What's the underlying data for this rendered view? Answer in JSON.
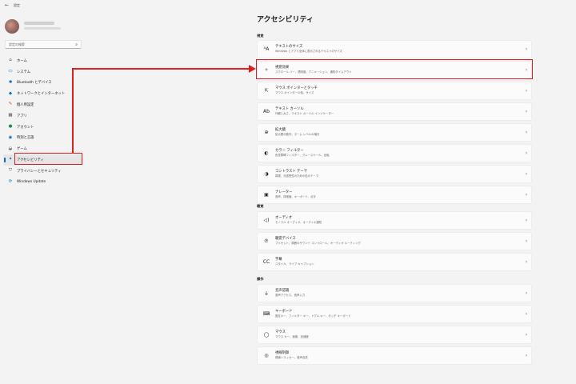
{
  "window": {
    "title": "設定",
    "back_glyph": "←"
  },
  "sidebar": {
    "search_placeholder": "設定の検索",
    "search_icon": "search-icon",
    "items": [
      {
        "label": "ホーム",
        "icon": "home-icon",
        "glyph": "⌂",
        "color": "#444444"
      },
      {
        "label": "システム",
        "icon": "system-icon",
        "glyph": "▭",
        "color": "#0067c0"
      },
      {
        "label": "Bluetooth とデバイス",
        "icon": "bluetooth-icon",
        "glyph": "✱",
        "color": "#0067c0"
      },
      {
        "label": "ネットワークとインターネット",
        "icon": "network-icon",
        "glyph": "◆",
        "color": "#0078d4"
      },
      {
        "label": "個人用設定",
        "icon": "personalization-icon",
        "glyph": "✎",
        "color": "#c05a1a"
      },
      {
        "label": "アプリ",
        "icon": "apps-icon",
        "glyph": "▦",
        "color": "#555555"
      },
      {
        "label": "アカウント",
        "icon": "account-icon",
        "glyph": "●",
        "color": "#1f8a4c"
      },
      {
        "label": "時刻と言語",
        "icon": "time-language-icon",
        "glyph": "◉",
        "color": "#0067c0"
      },
      {
        "label": "ゲーム",
        "icon": "gaming-icon",
        "glyph": "◒",
        "color": "#666666"
      },
      {
        "label": "アクセシビリティ",
        "icon": "accessibility-icon",
        "glyph": "✦",
        "color": "#0067c0",
        "active": true
      },
      {
        "label": "プライバシーとセキュリティ",
        "icon": "shield-icon",
        "glyph": "⛉",
        "color": "#555555"
      },
      {
        "label": "Windows Update",
        "icon": "windows-update-icon",
        "glyph": "⟳",
        "color": "#0078d4"
      }
    ]
  },
  "main": {
    "title": "アクセシビリティ",
    "sections": [
      {
        "title": "視覚",
        "cards": [
          {
            "title": "テキストのサイズ",
            "desc": "Windows とアプリ全体に表示されるテキストのサイズ",
            "icon": "text-size-icon",
            "glyph": "ᴬA"
          },
          {
            "title": "視覚効果",
            "desc": "スクロール バー、透明度、アニメーション、通知タイムアウト",
            "icon": "visual-effects-icon",
            "glyph": "✧"
          },
          {
            "title": "マウス ポインターとタッチ",
            "desc": "マウス ポインターの色、サイズ",
            "icon": "mouse-pointer-icon",
            "glyph": "⇱"
          },
          {
            "title": "テキスト カーソル",
            "desc": "外観と太さ、テキスト カーソル インジケーター",
            "icon": "text-cursor-icon",
            "glyph": "Ab"
          },
          {
            "title": "拡大鏡",
            "desc": "拡大鏡の動作、ズーム レベルの増分",
            "icon": "magnifier-icon",
            "glyph": "⊕"
          },
          {
            "title": "カラー フィルター",
            "desc": "色覚障碍フィルター、グレースケール、反転",
            "icon": "color-filter-icon",
            "glyph": "◐"
          },
          {
            "title": "コントラスト テーマ",
            "desc": "弱視、光感受性のための色のテーマ",
            "icon": "contrast-theme-icon",
            "glyph": "◑"
          },
          {
            "title": "ナレーター",
            "desc": "音声、詳細度、キーボード、点字",
            "icon": "narrator-icon",
            "glyph": "▣"
          }
        ]
      },
      {
        "title": "聴覚",
        "cards": [
          {
            "title": "オーディオ",
            "desc": "モノラル オーディオ、オーディオ通知",
            "icon": "audio-icon",
            "glyph": "◁)"
          },
          {
            "title": "聴覚デバイス",
            "desc": "プリセット、周囲のサウンド コントロール、オーディオ ルーティング",
            "icon": "hearing-device-icon",
            "glyph": "℗"
          },
          {
            "title": "字幕",
            "desc": "スタイル、ライブ キャプション",
            "icon": "captions-icon",
            "glyph": "CC"
          }
        ]
      },
      {
        "title": "操作",
        "cards": [
          {
            "title": "音声認識",
            "desc": "音声アクセス、音声入力",
            "icon": "microphone-icon",
            "glyph": "⏚"
          },
          {
            "title": "キーボード",
            "desc": "固定キー、フィルター キー、トグル キー、タッチ キーボード",
            "icon": "keyboard-icon",
            "glyph": "⌨"
          },
          {
            "title": "マウス",
            "desc": "マウス キー、速度、加速度",
            "icon": "mouse-icon",
            "glyph": "◯"
          },
          {
            "title": "視線制御",
            "desc": "視線トラッカー、音声合成",
            "icon": "eye-control-icon",
            "glyph": "◎"
          }
        ]
      }
    ],
    "chevron": "›"
  },
  "colors": {
    "highlight": "#e02020",
    "accent": "#0067c0"
  }
}
